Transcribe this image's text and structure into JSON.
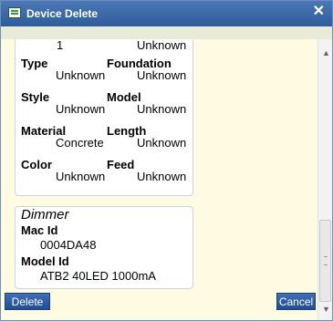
{
  "window": {
    "title": "Device Delete"
  },
  "panel1": {
    "top_value_left": "1",
    "top_value_right": "Unknown",
    "rows": [
      {
        "left_label": "Type",
        "right_label": "Foundation",
        "left_value": "Unknown",
        "right_value": "Unknown"
      },
      {
        "left_label": "Style",
        "right_label": "Model",
        "left_value": "Unknown",
        "right_value": "Unknown"
      },
      {
        "left_label": "Material",
        "right_label": "Length",
        "left_value": "Concrete",
        "right_value": "Unknown"
      },
      {
        "left_label": "Color",
        "right_label": "Feed",
        "left_value": "Unknown",
        "right_value": "Unknown"
      }
    ]
  },
  "panel2": {
    "section_title": "Dimmer",
    "mac_label": "Mac Id",
    "mac_value": "0004DA48",
    "model_label": "Model Id",
    "model_value": "ATB2 40LED 1000mA"
  },
  "footer": {
    "delete_label": "Delete",
    "cancel_label": "Cancel"
  }
}
